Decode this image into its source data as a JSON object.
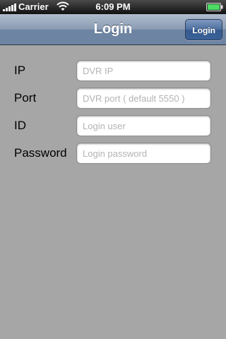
{
  "status_bar": {
    "carrier": "Carrier",
    "time": "6:09 PM",
    "signal_icon": "signal-bars-icon",
    "wifi_icon": "wifi-icon",
    "battery_icon": "battery-icon"
  },
  "nav_bar": {
    "title": "Login",
    "login_button_label": "Login"
  },
  "form": {
    "fields": [
      {
        "label": "IP",
        "value": "",
        "placeholder": "DVR IP"
      },
      {
        "label": "Port",
        "value": "",
        "placeholder": "DVR port ( default 5550 )"
      },
      {
        "label": "ID",
        "value": "",
        "placeholder": "Login user"
      },
      {
        "label": "Password",
        "value": "",
        "placeholder": "Login password"
      }
    ]
  },
  "colors": {
    "background": "#a6a6a6",
    "nav_bar": "#6d84a2",
    "nav_button": "#345a8e",
    "battery": "#4cd964"
  }
}
